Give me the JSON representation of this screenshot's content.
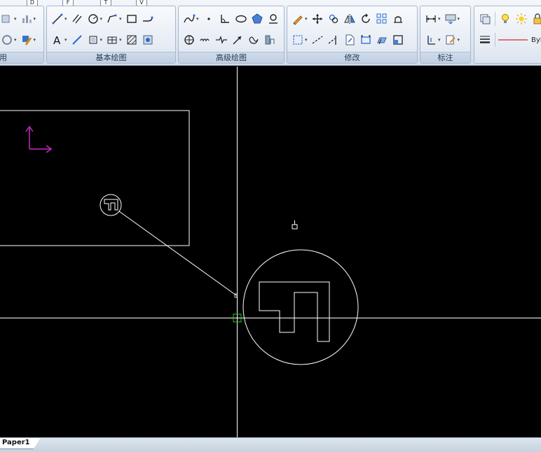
{
  "ribbon": {
    "panels": {
      "left_partial_label": "用",
      "draw": "基本绘图",
      "advanced_draw": "高级绘图",
      "modify": "修改",
      "annotate": "标注"
    },
    "key_tips": [
      "D",
      "F",
      "T",
      "V"
    ],
    "linetype_value": "ByLa"
  },
  "layout_tabs": [
    {
      "label": "Paper1",
      "active": true
    }
  ],
  "colors": {
    "canvas_bg": "#000000",
    "entity": "#ffffff",
    "ucs_icon": "#c02cc0",
    "snap_marker": "#22cc22",
    "linetype_line": "#d22a2a"
  }
}
